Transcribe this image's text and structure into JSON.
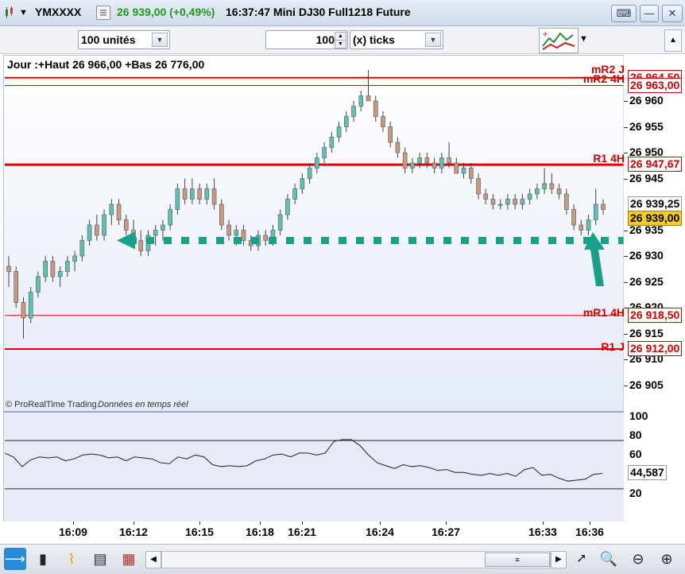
{
  "window": {
    "symbol": "YMXXXX",
    "price_change": "26 939,00 (+0,49%)",
    "title": "16:37:47 Mini DJ30 Full1218 Future",
    "buttons": [
      "keyboard-icon",
      "minimize-icon",
      "maximize-icon",
      "close-icon"
    ]
  },
  "toolbar": {
    "units_value": "100 unités",
    "ticks_value": "100",
    "ticks_mode": "(x) ticks"
  },
  "chart": {
    "header": "Jour :+Haut 26 966,00 +Bas 26 776,00",
    "footer_brand": "© ProRealTime Trading",
    "footer_status": "Données en temps réel",
    "y_ticks": [
      "26 960",
      "26 955",
      "26 950",
      "26 945",
      "26 935",
      "26 930",
      "26 925",
      "26 920",
      "26 915",
      "26 910",
      "26 905"
    ],
    "current_price": "26 939,00",
    "last_price": "26 939,25",
    "levels": [
      {
        "name": "mR2 J",
        "value": "26 964,50",
        "price": 26964.5,
        "color": "#e00000",
        "width": 2
      },
      {
        "name": "mR2 4H",
        "value": "26 963,00",
        "price": 26963.0,
        "color": "#e00000",
        "width": 1
      },
      {
        "name": "R1 4H",
        "value": "26 947,67",
        "price": 26947.67,
        "color": "#e00000",
        "width": 3
      },
      {
        "name": "mR1 4H",
        "value": "26 918,50",
        "price": 26918.5,
        "color": "#e00000",
        "width": 1
      },
      {
        "name": "R1 J",
        "value": "26 912,00",
        "price": 26912.0,
        "color": "#e00000",
        "width": 2
      }
    ],
    "support_price": 26933.0,
    "accent": "#1aa08a",
    "up_color": "#5fc0b3",
    "down_color": "#c79a82"
  },
  "oscillator": {
    "y_ticks": [
      "100",
      "80",
      "60",
      "20"
    ],
    "current_value": "44,587",
    "upper_band": 75,
    "lower_band": 25
  },
  "time_axis": [
    "16:09",
    "16:12",
    "16:15",
    "16:18",
    "16:21",
    "16:24",
    "16:27",
    "16:33",
    "16:36"
  ],
  "chart_data": {
    "type": "candlestick",
    "x_labels": [
      "16:09",
      "16:12",
      "16:15",
      "16:18",
      "16:21",
      "16:24",
      "16:27",
      "16:33",
      "16:36"
    ],
    "ylim": [
      26902,
      26966
    ],
    "candles_ohlc": [
      [
        26928,
        26930,
        26924,
        26927
      ],
      [
        26927,
        26928,
        26920,
        26921
      ],
      [
        26921,
        26922,
        26914,
        26918
      ],
      [
        26918,
        26924,
        26917,
        26923
      ],
      [
        26923,
        26927,
        26922,
        26926
      ],
      [
        26926,
        26930,
        26925,
        26929
      ],
      [
        26929,
        26930,
        26925,
        26926
      ],
      [
        26926,
        26928,
        26924,
        26927
      ],
      [
        26927,
        26930,
        26926,
        26929
      ],
      [
        26929,
        26931,
        26927,
        26930
      ],
      [
        26930,
        26934,
        26929,
        26933
      ],
      [
        26933,
        26937,
        26932,
        26936
      ],
      [
        26936,
        26938,
        26933,
        26934
      ],
      [
        26934,
        26939,
        26933,
        26938
      ],
      [
        26938,
        26941,
        26936,
        26940
      ],
      [
        26940,
        26941,
        26936,
        26937
      ],
      [
        26937,
        26938,
        26934,
        26935
      ],
      [
        26935,
        26937,
        26932,
        26933
      ],
      [
        26933,
        26935,
        26930,
        26931
      ],
      [
        26931,
        26935,
        26930,
        26934
      ],
      [
        26934,
        26936,
        26932,
        26935
      ],
      [
        26935,
        26937,
        26933,
        26936
      ],
      [
        26936,
        26940,
        26935,
        26939
      ],
      [
        26939,
        26944,
        26938,
        26943
      ],
      [
        26943,
        26945,
        26940,
        26941
      ],
      [
        26941,
        26945,
        26940,
        26943
      ],
      [
        26943,
        26944,
        26940,
        26941
      ],
      [
        26941,
        26944,
        26940,
        26943
      ],
      [
        26943,
        26945,
        26939,
        26940
      ],
      [
        26940,
        26941,
        26935,
        26936
      ],
      [
        26936,
        26937,
        26933,
        26934
      ],
      [
        26934,
        26936,
        26932,
        26935
      ],
      [
        26935,
        26936,
        26932,
        26933
      ],
      [
        26933,
        26934,
        26931,
        26932
      ],
      [
        26932,
        26935,
        26931,
        26934
      ],
      [
        26934,
        26935,
        26932,
        26933
      ],
      [
        26933,
        26936,
        26932,
        26935
      ],
      [
        26935,
        26939,
        26934,
        26938
      ],
      [
        26938,
        26942,
        26937,
        26941
      ],
      [
        26941,
        26944,
        26940,
        26943
      ],
      [
        26943,
        26946,
        26942,
        26945
      ],
      [
        26945,
        26948,
        26944,
        26947
      ],
      [
        26947,
        26950,
        26946,
        26949
      ],
      [
        26949,
        26952,
        26948,
        26951
      ],
      [
        26951,
        26954,
        26950,
        26953
      ],
      [
        26953,
        26956,
        26952,
        26955
      ],
      [
        26955,
        26958,
        26954,
        26957
      ],
      [
        26957,
        26960,
        26956,
        26959
      ],
      [
        26959,
        26962,
        26958,
        26961
      ],
      [
        26961,
        26966,
        26960,
        26960
      ],
      [
        26960,
        26961,
        26956,
        26957
      ],
      [
        26957,
        26958,
        26954,
        26955
      ],
      [
        26955,
        26956,
        26951,
        26952
      ],
      [
        26952,
        26953,
        26949,
        26950
      ],
      [
        26950,
        26951,
        26946,
        26947
      ],
      [
        26947,
        26949,
        26946,
        26948
      ],
      [
        26948,
        26950,
        26947,
        26949
      ],
      [
        26949,
        26950,
        26947,
        26948
      ],
      [
        26948,
        26949,
        26946,
        26947
      ],
      [
        26947,
        26950,
        26946,
        26949
      ],
      [
        26949,
        26952,
        26947,
        26948
      ],
      [
        26948,
        26949,
        26946,
        26946
      ],
      [
        26946,
        26948,
        26945,
        26947
      ],
      [
        26947,
        26948,
        26944,
        26945
      ],
      [
        26945,
        26946,
        26941,
        26942
      ],
      [
        26942,
        26943,
        26940,
        26941
      ],
      [
        26941,
        26942,
        26939,
        26940
      ],
      [
        26940,
        26941,
        26939,
        26940
      ],
      [
        26940,
        26942,
        26939,
        26941
      ],
      [
        26941,
        26942,
        26939,
        26940
      ],
      [
        26940,
        26942,
        26939,
        26941
      ],
      [
        26941,
        26943,
        26940,
        26942
      ],
      [
        26942,
        26944,
        26941,
        26943
      ],
      [
        26943,
        26947,
        26942,
        26944
      ],
      [
        26944,
        26946,
        26942,
        26943
      ],
      [
        26943,
        26944,
        26941,
        26942
      ],
      [
        26942,
        26943,
        26938,
        26939
      ],
      [
        26939,
        26940,
        26935,
        26936
      ],
      [
        26936,
        26937,
        26934,
        26935
      ],
      [
        26935,
        26938,
        26934,
        26937
      ],
      [
        26937,
        26943,
        26936,
        26940
      ],
      [
        26940,
        26941,
        26938,
        26939
      ]
    ]
  }
}
